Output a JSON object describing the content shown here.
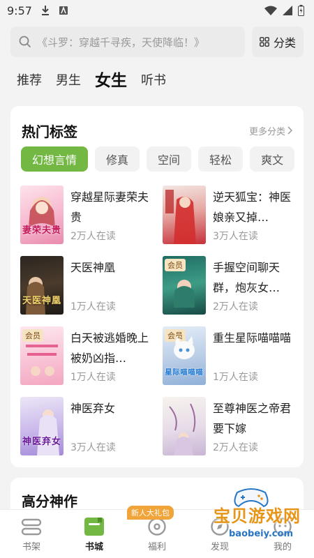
{
  "status_bar": {
    "time": "9:57"
  },
  "search": {
    "placeholder": "《斗罗：穿越千寻疾，天使降临！》",
    "category_label": "分类"
  },
  "channel_tabs": [
    {
      "label": "推荐",
      "active": false
    },
    {
      "label": "男生",
      "active": false
    },
    {
      "label": "女生",
      "active": true
    },
    {
      "label": "听书",
      "active": false
    }
  ],
  "hot_tags": {
    "title": "热门标签",
    "more_label": "更多分类",
    "tags": [
      {
        "label": "幻想言情",
        "active": true
      },
      {
        "label": "修真",
        "active": false
      },
      {
        "label": "空间",
        "active": false
      },
      {
        "label": "轻松",
        "active": false
      },
      {
        "label": "爽文",
        "active": false
      }
    ],
    "books": [
      {
        "title": "穿越星际妻荣夫贵",
        "readers": "2万人在读",
        "vip": false,
        "cover_text": "妻荣夫贵"
      },
      {
        "title": "逆天狐宝：神医娘亲又掉马",
        "title_display": "逆天狐宝：神医娘亲又掉…",
        "readers": "3万人在读",
        "vip": false,
        "cover_text": ""
      },
      {
        "title": "天医神凰",
        "readers": "1万人在读",
        "vip": false,
        "cover_text": "天医神凰"
      },
      {
        "title": "手握空间聊天群，炮灰女…",
        "readers": "2万人在读",
        "vip": true,
        "cover_text": ""
      },
      {
        "title": "白天被逃婚晚上被奶凶指…",
        "readers": "1万人在读",
        "vip": true,
        "cover_text": ""
      },
      {
        "title": "重生星际喵喵喵",
        "readers": "1万人在读",
        "vip": true,
        "cover_text": "星际喵喵喵"
      },
      {
        "title": "神医弃女",
        "readers": "3万人在读",
        "vip": false,
        "cover_text": "神医弃女"
      },
      {
        "title": "至尊神医之帝君要下嫁",
        "readers": "2万人在读",
        "vip": false,
        "cover_text": ""
      }
    ],
    "vip_label": "会员"
  },
  "high_score": {
    "title": "高分神作"
  },
  "bottom_nav": [
    {
      "label": "书架",
      "active": false
    },
    {
      "label": "书城",
      "active": true
    },
    {
      "label": "福利",
      "active": false,
      "badge": "新人大礼包"
    },
    {
      "label": "发现",
      "active": false
    },
    {
      "label": "我的",
      "active": false
    }
  ],
  "watermark": {
    "text": "宝贝游戏网",
    "url": "baobeiy.com"
  },
  "colors": {
    "accent": "#72b842",
    "badge": "#f0a43a",
    "vip_bg": "#f6e3c2"
  }
}
